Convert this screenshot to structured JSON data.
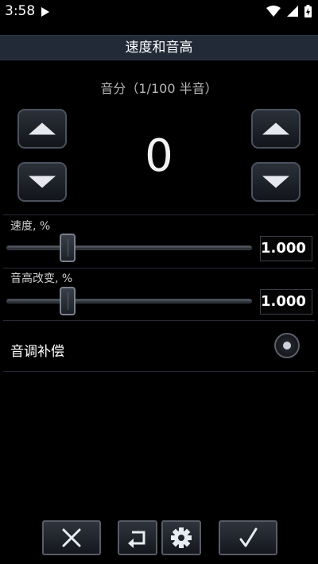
{
  "status_bar": {
    "time": "3:58"
  },
  "title": "速度和音高",
  "cents": {
    "label": "音分（1/100 半音）",
    "value": "0"
  },
  "speed": {
    "label": "速度, %",
    "value": "1.000",
    "position": 0.25
  },
  "pitch": {
    "label": "音高改变, %",
    "value": "1.000",
    "position": 0.25
  },
  "pitch_compensation": {
    "label": "音调补偿",
    "enabled": true
  },
  "icons": {
    "status": [
      "play-icon",
      "wifi-icon",
      "signal-icon",
      "battery-charging-icon"
    ],
    "bottom": [
      "close-icon",
      "undo-icon",
      "settings-icon",
      "checkmark-icon"
    ]
  }
}
